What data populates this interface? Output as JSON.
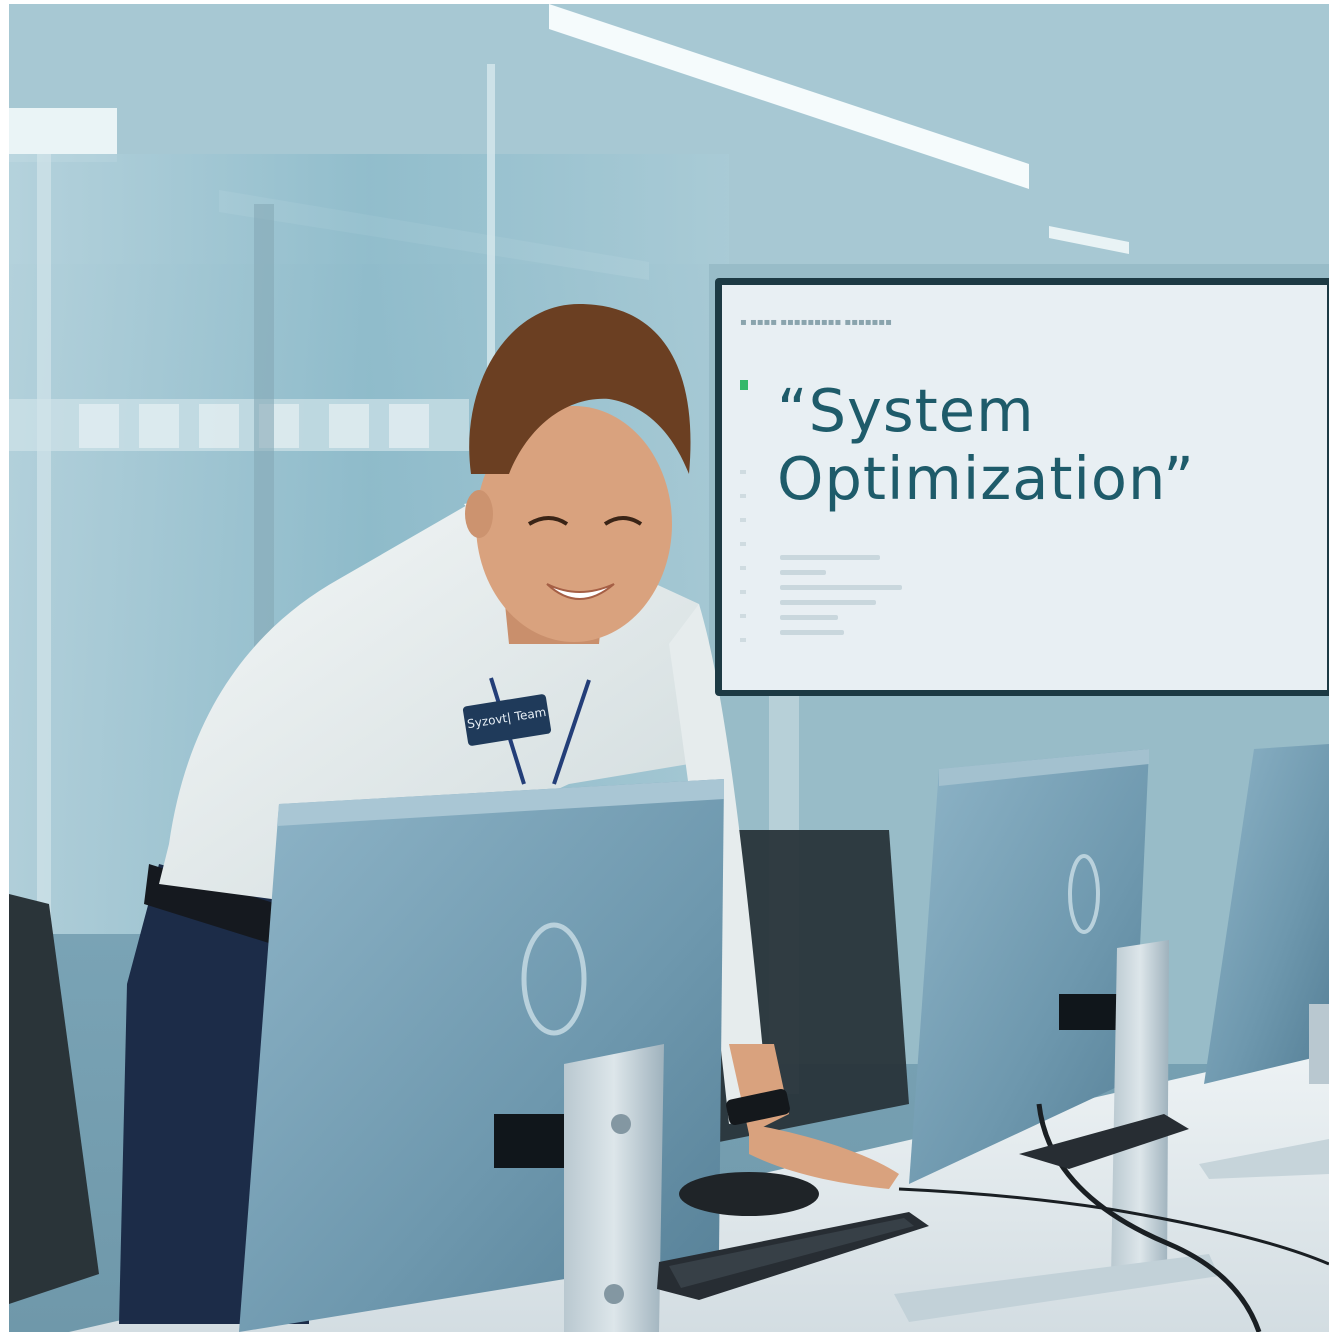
{
  "scene": {
    "description_tags": [
      "office",
      "technician",
      "monitors",
      "wall-display"
    ],
    "palette": {
      "wall_glass": "#9ec2cf",
      "display_bezel": "#1d3a44",
      "display_screen": "#e8eff3",
      "display_text": "#1e5b6a",
      "accent_green": "#34b86a",
      "shirt": "#eef2f2",
      "trousers": "#1c2c48",
      "hair": "#6b3f22",
      "skin": "#d9a27e",
      "monitor_back": "#7fa6bb",
      "monitor_stand": "#9fb3bf",
      "desk": "#e9eef1",
      "badge": "#1f3a5a"
    }
  },
  "display": {
    "title": "“System Optimization”"
  },
  "badge": {
    "text": "Syzovt| Team"
  }
}
